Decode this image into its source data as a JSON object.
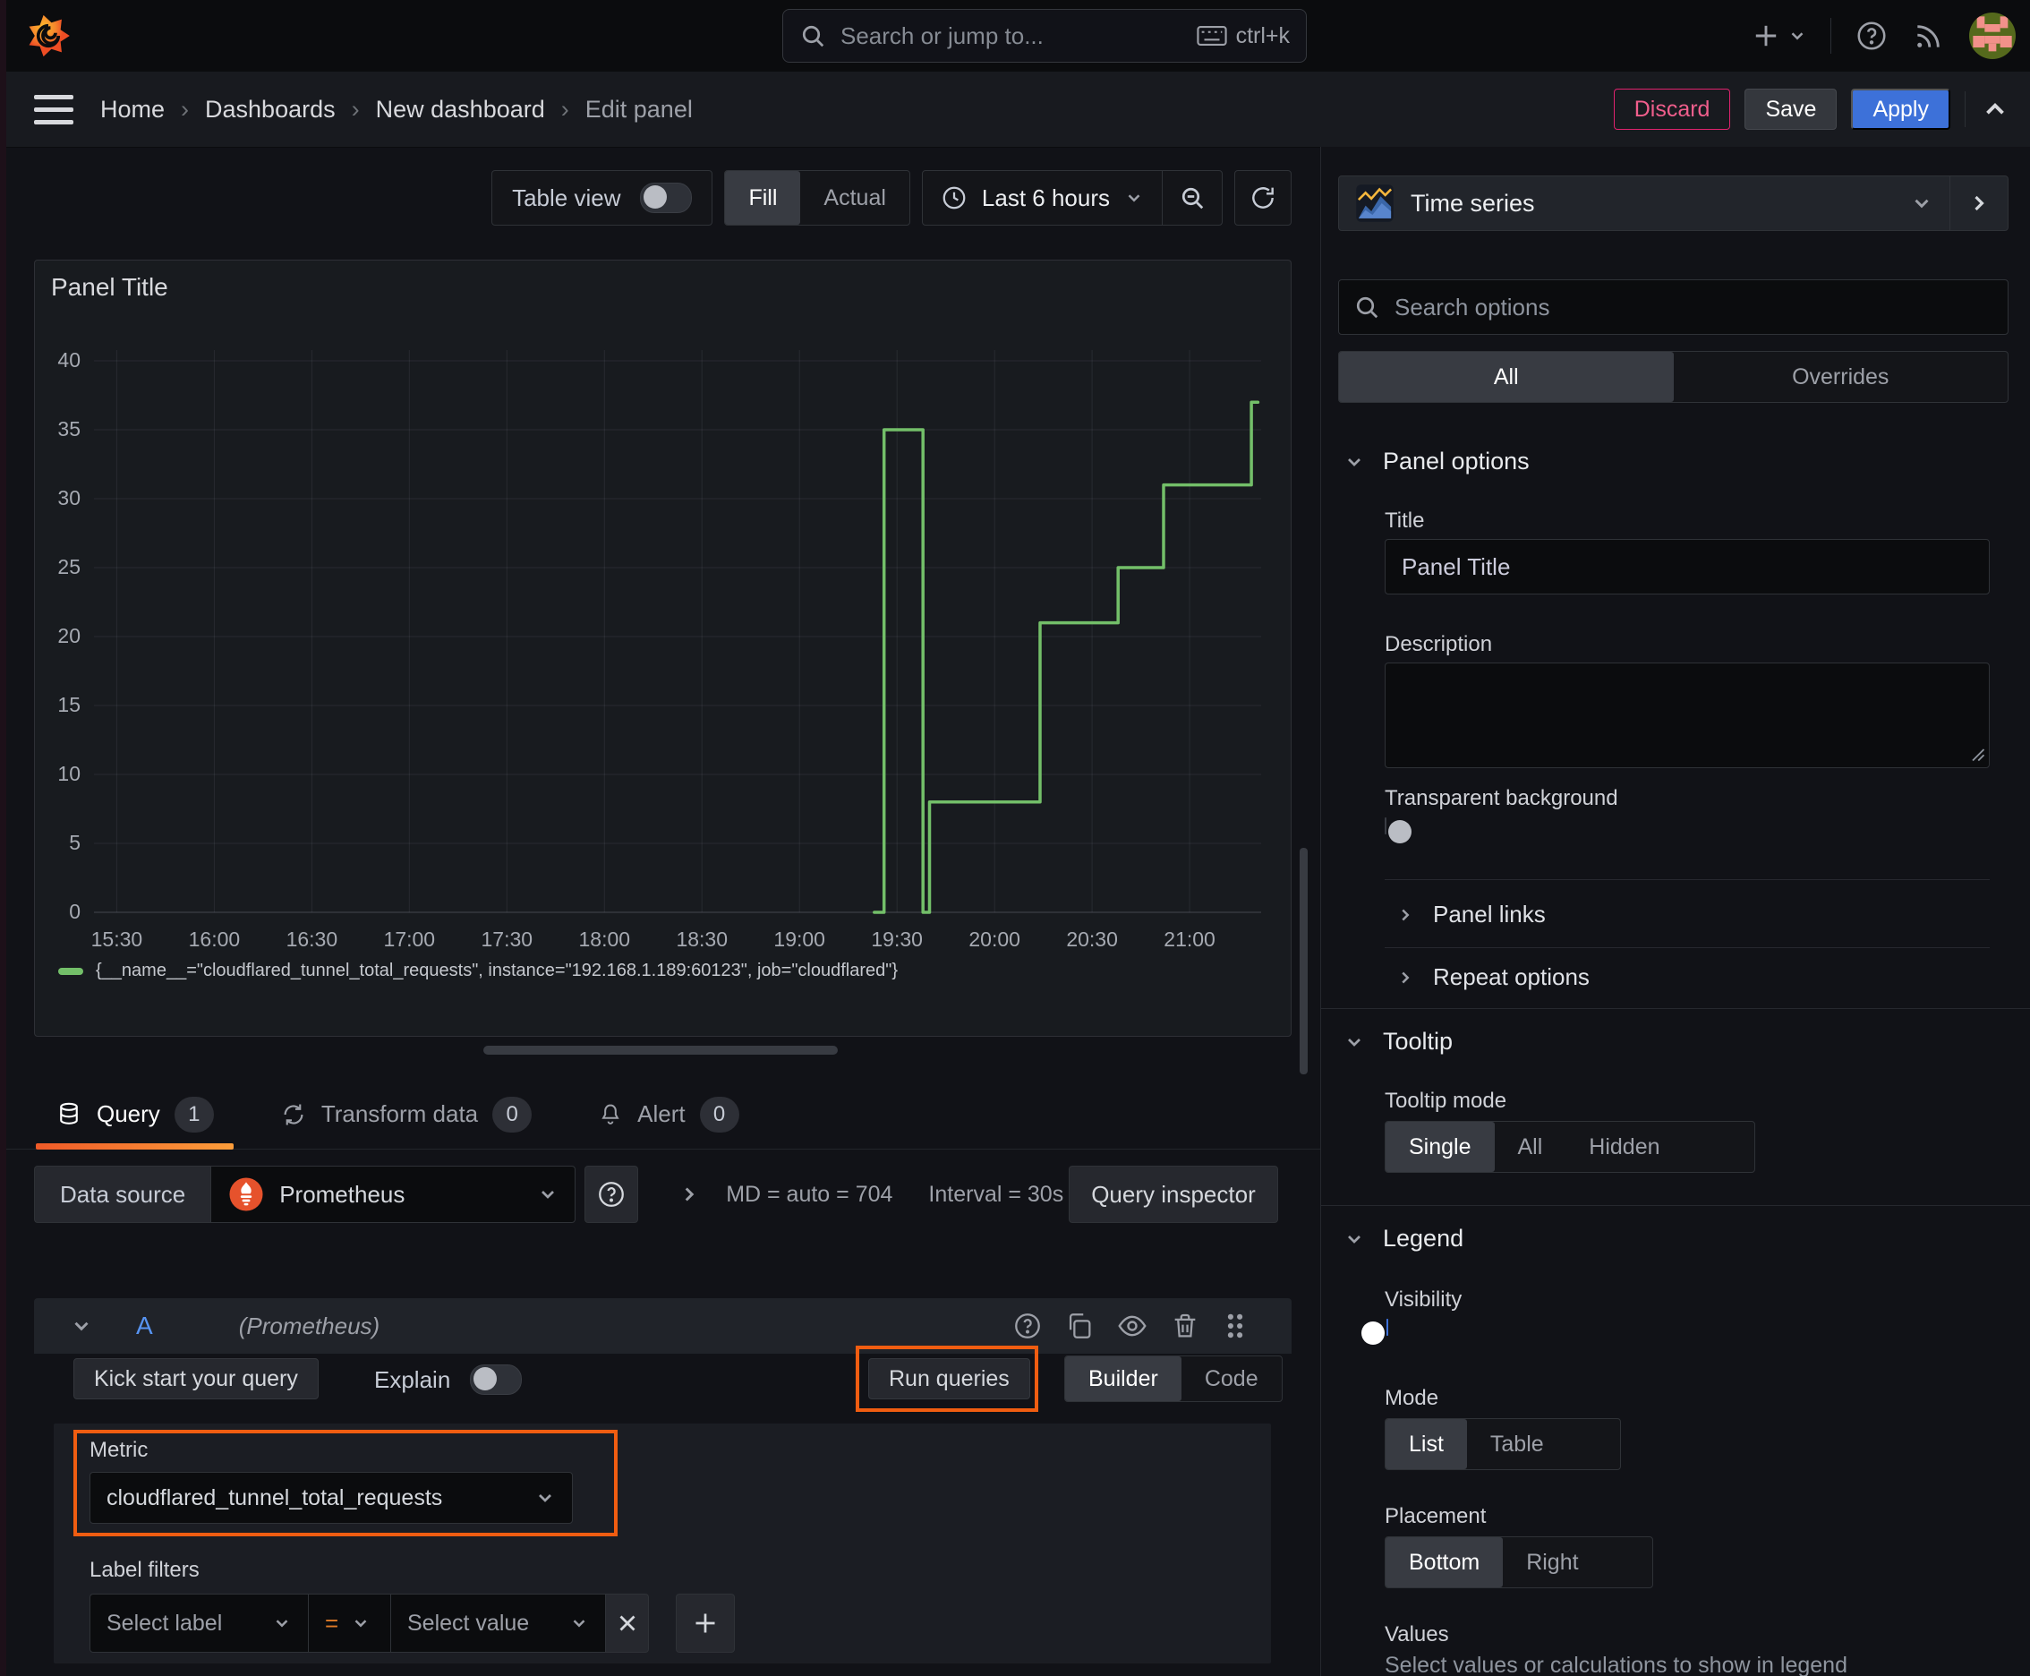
{
  "topnav": {
    "search_placeholder": "Search or jump to...",
    "search_shortcut": "ctrl+k"
  },
  "breadcrumb": {
    "items": [
      "Home",
      "Dashboards",
      "New dashboard",
      "Edit panel"
    ],
    "discard_label": "Discard",
    "save_label": "Save",
    "apply_label": "Apply"
  },
  "toolbar": {
    "table_view_label": "Table view",
    "fill_label": "Fill",
    "actual_label": "Actual",
    "time_range_label": "Last 6 hours"
  },
  "panel": {
    "title": "Panel Title",
    "legend_text": "{__name__=\"cloudflared_tunnel_total_requests\", instance=\"192.168.1.189:60123\", job=\"cloudflared\"}"
  },
  "chart_data": {
    "type": "line",
    "title": "Panel Title",
    "step": true,
    "grid": true,
    "legend_position": "bottom",
    "x_ticks": [
      "15:30",
      "16:00",
      "16:30",
      "17:00",
      "17:30",
      "18:00",
      "18:30",
      "19:00",
      "19:30",
      "20:00",
      "20:30",
      "21:00"
    ],
    "x_range": [
      "15:23",
      "21:22"
    ],
    "y_ticks": [
      0,
      5,
      10,
      15,
      20,
      25,
      30,
      35,
      40
    ],
    "ylim": [
      0,
      40
    ],
    "series": [
      {
        "name": "{__name__=\"cloudflared_tunnel_total_requests\", instance=\"192.168.1.189:60123\", job=\"cloudflared\"}",
        "color": "#73bf69",
        "points": [
          [
            "19:23",
            0
          ],
          [
            "19:26",
            0
          ],
          [
            "19:26",
            35
          ],
          [
            "19:38",
            35
          ],
          [
            "19:38",
            0
          ],
          [
            "19:40",
            0
          ],
          [
            "19:40",
            8
          ],
          [
            "20:14",
            8
          ],
          [
            "20:14",
            21
          ],
          [
            "20:38",
            21
          ],
          [
            "20:38",
            25
          ],
          [
            "20:52",
            25
          ],
          [
            "20:52",
            31
          ],
          [
            "21:19",
            31
          ],
          [
            "21:19",
            37
          ],
          [
            "21:21",
            37
          ]
        ]
      }
    ]
  },
  "query_tabs": {
    "query_label": "Query",
    "query_count": "1",
    "transform_label": "Transform data",
    "transform_count": "0",
    "alert_label": "Alert",
    "alert_count": "0"
  },
  "datasource_row": {
    "label": "Data source",
    "datasource_name": "Prometheus",
    "stats_md": "MD = auto = 704",
    "stats_interval": "Interval = 30s",
    "query_inspector_label": "Query inspector"
  },
  "query_editor": {
    "ref_id": "A",
    "ds_hint": "(Prometheus)",
    "kick_start_label": "Kick start your query",
    "explain_label": "Explain",
    "run_queries_label": "Run queries",
    "builder_label": "Builder",
    "code_label": "Code",
    "metric_label": "Metric",
    "metric_value": "cloudflared_tunnel_total_requests",
    "label_filters_label": "Label filters",
    "select_label_placeholder": "Select label",
    "operator": "=",
    "select_value_placeholder": "Select value"
  },
  "options": {
    "viz_type": "Time series",
    "search_placeholder": "Search options",
    "tab_all": "All",
    "tab_overrides": "Overrides",
    "panel_options": {
      "title": "Panel options",
      "title_label": "Title",
      "title_value": "Panel Title",
      "description_label": "Description",
      "transparent_label": "Transparent background"
    },
    "panel_links_label": "Panel links",
    "repeat_options_label": "Repeat options",
    "tooltip": {
      "title": "Tooltip",
      "mode_label": "Tooltip mode",
      "modes": [
        "Single",
        "All",
        "Hidden"
      ]
    },
    "legend": {
      "title": "Legend",
      "visibility_label": "Visibility",
      "mode_label": "Mode",
      "modes": [
        "List",
        "Table"
      ],
      "placement_label": "Placement",
      "placements": [
        "Bottom",
        "Right"
      ],
      "values_label": "Values",
      "values_hint": "Select values or calculations to show in legend"
    }
  },
  "colors": {
    "series_green": "#73bf69",
    "accent_orange": "#f05d11",
    "primary_blue": "#3d71d9",
    "destructive_pink": "#e0226e"
  }
}
